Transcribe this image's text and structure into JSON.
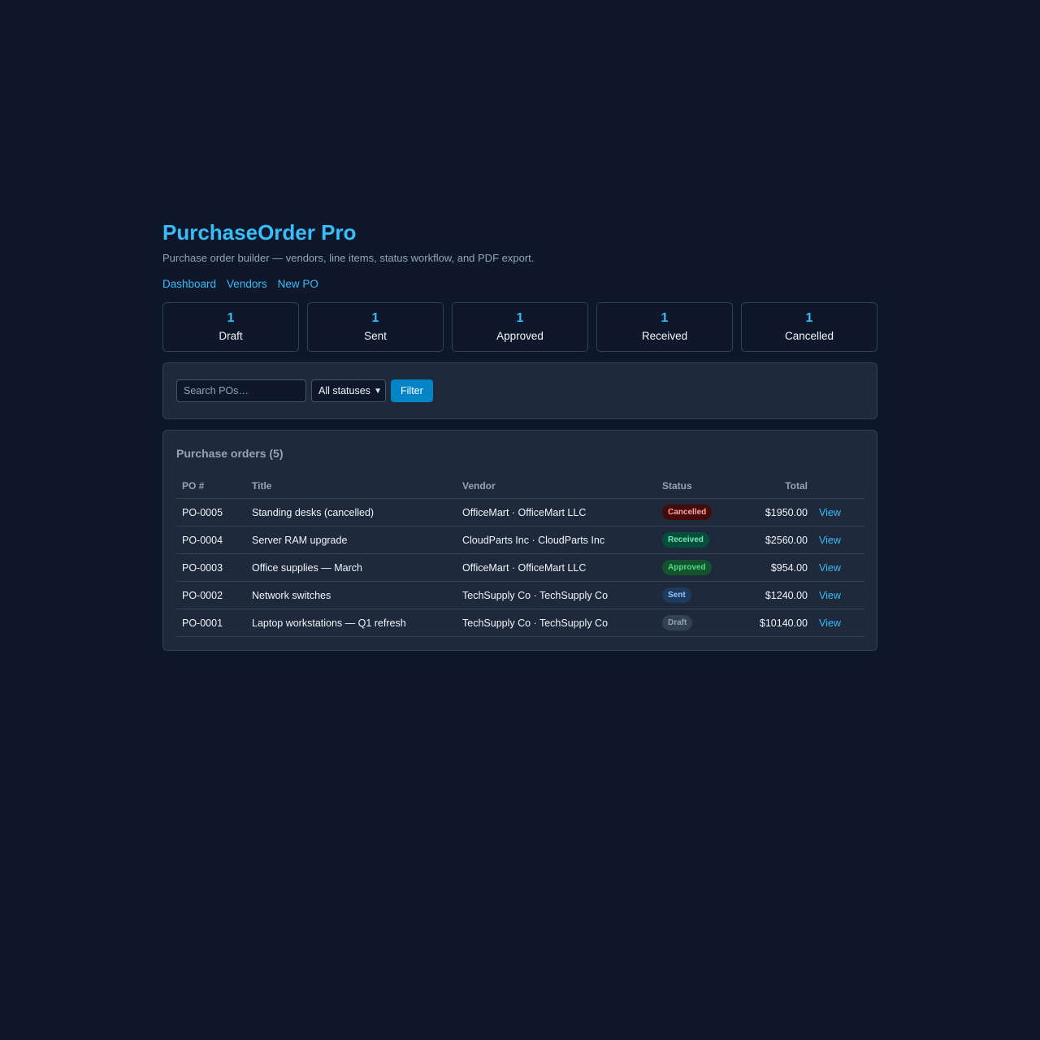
{
  "app": {
    "title": "PurchaseOrder Pro",
    "subtitle": "Purchase order builder — vendors, line items, status workflow, and PDF export."
  },
  "nav": [
    "Dashboard",
    "Vendors",
    "New PO"
  ],
  "stats": [
    {
      "count": "1",
      "label": "Draft"
    },
    {
      "count": "1",
      "label": "Sent"
    },
    {
      "count": "1",
      "label": "Approved"
    },
    {
      "count": "1",
      "label": "Received"
    },
    {
      "count": "1",
      "label": "Cancelled"
    }
  ],
  "filter": {
    "search_placeholder": "Search POs…",
    "search_value": "",
    "status_selected": "All statuses",
    "button_label": "Filter"
  },
  "orders": {
    "heading": "Purchase orders (5)",
    "columns": [
      "PO #",
      "Title",
      "Vendor",
      "Status",
      "Total",
      ""
    ],
    "rows": [
      {
        "po": "PO-0005",
        "title": "Standing desks (cancelled)",
        "vendor": "OfficeMart · OfficeMart LLC",
        "status": "Cancelled",
        "total": "$1950.00",
        "action": "View"
      },
      {
        "po": "PO-0004",
        "title": "Server RAM upgrade",
        "vendor": "CloudParts Inc · CloudParts Inc",
        "status": "Received",
        "total": "$2560.00",
        "action": "View"
      },
      {
        "po": "PO-0003",
        "title": "Office supplies — March",
        "vendor": "OfficeMart · OfficeMart LLC",
        "status": "Approved",
        "total": "$954.00",
        "action": "View"
      },
      {
        "po": "PO-0002",
        "title": "Network switches",
        "vendor": "TechSupply Co · TechSupply Co",
        "status": "Sent",
        "total": "$1240.00",
        "action": "View"
      },
      {
        "po": "PO-0001",
        "title": "Laptop workstations — Q1 refresh",
        "vendor": "TechSupply Co · TechSupply Co",
        "status": "Draft",
        "total": "$10140.00",
        "action": "View"
      }
    ]
  },
  "colors": {
    "background": "#0f172a",
    "panel": "#1e293b",
    "accent": "#38bdf8",
    "button": "#0284c7",
    "status": {
      "Cancelled": {
        "bg": "#450a0a",
        "fg": "#fca5a5"
      },
      "Received": {
        "bg": "#064e3b",
        "fg": "#6ee7b7"
      },
      "Approved": {
        "bg": "#14532d",
        "fg": "#4ade80"
      },
      "Sent": {
        "bg": "#1e3a5f",
        "fg": "#93c5fd"
      },
      "Draft": {
        "bg": "#334155",
        "fg": "#94a3b8"
      }
    }
  }
}
